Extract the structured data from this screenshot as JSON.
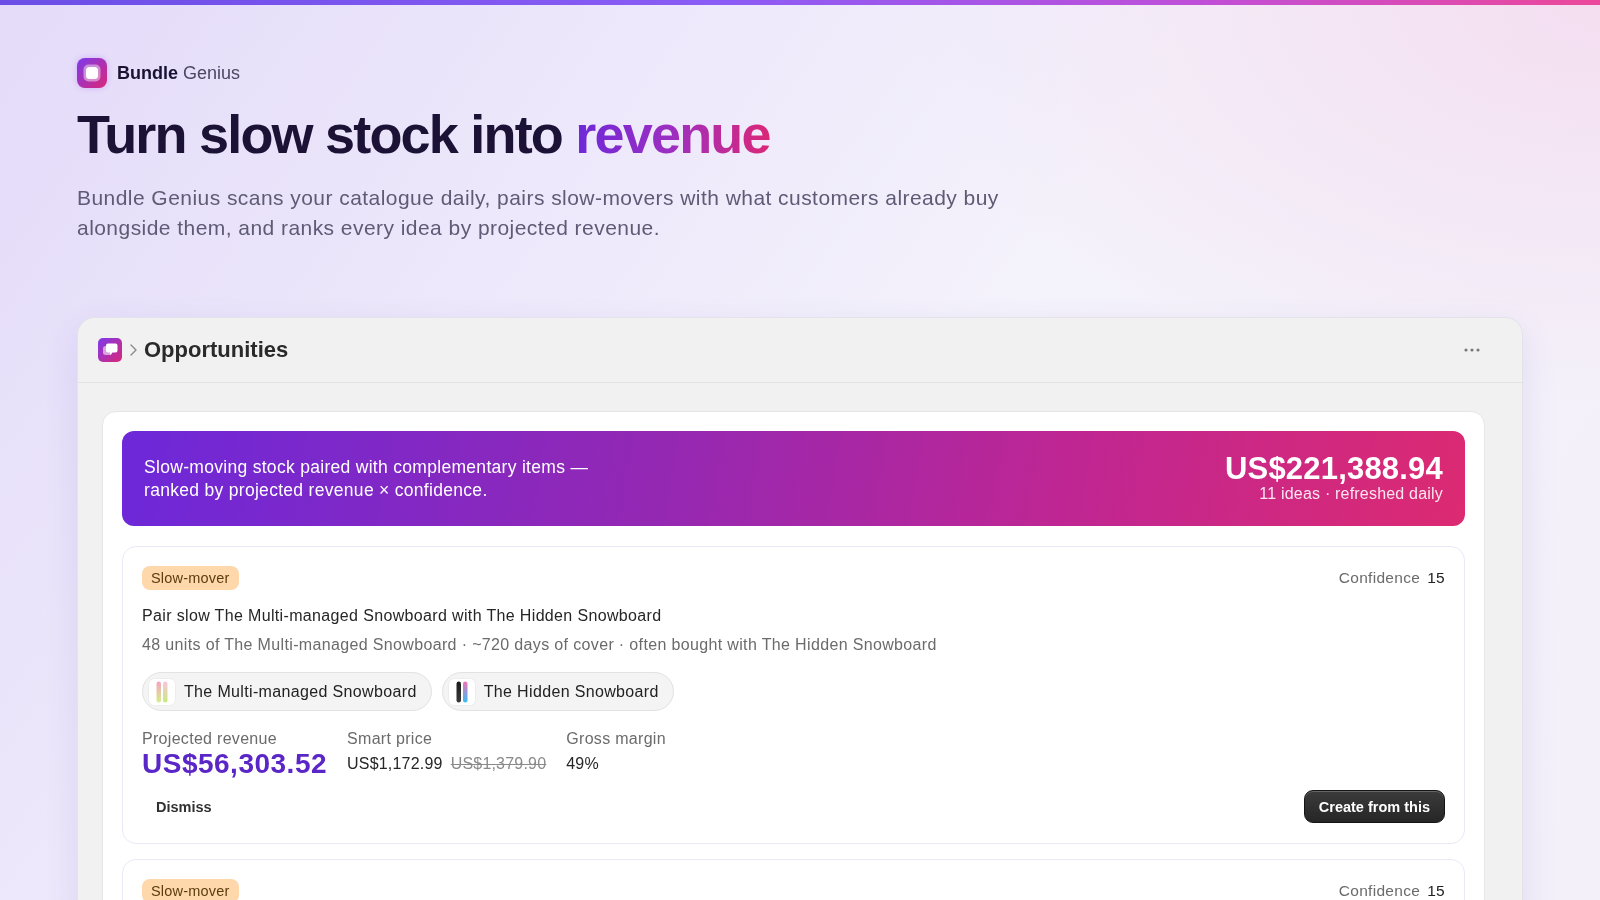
{
  "brand": {
    "name": "**Bundle** Genius"
  },
  "hero": {
    "title": "Turn slow stock into",
    "title_highlight": "revenue",
    "subtitle_lines": [
      "Bundle Genius scans your catalogue daily, pairs slow-movers with what customers already buy",
      "alongside them, and ranks every idea by projected revenue."
    ]
  },
  "panel": {
    "title": "Opportunities"
  },
  "summary": {
    "text_lines": [
      "Slow-moving stock paired with complementary items —",
      "ranked by projected revenue × confidence."
    ],
    "total": "US$221,388.94",
    "caption": "11 ideas · refreshed daily"
  },
  "opportunities": [
    {
      "badge": "Slow-mover",
      "confidence_label": "Confidence",
      "confidence": "15",
      "title": "Pair slow The Multi-managed Snowboard with The Hidden Snowboard",
      "detail": "48 units of The Multi-managed Snowboard · ~720 days of cover · often bought with The Hidden Snowboard",
      "products": [
        {
          "name": "The Multi-managed Snowboard"
        },
        {
          "name": "The Hidden Snowboard"
        }
      ],
      "metrics": [
        {
          "kind": "revenue",
          "label": "Projected revenue",
          "value": "US$56,303.52"
        },
        {
          "kind": "price",
          "label": "Smart price",
          "value": "US$1,172.99",
          "was": "US$1,379.90"
        },
        {
          "kind": "plain",
          "label": "Gross margin",
          "value": "49%"
        }
      ],
      "actions": [
        {
          "kind": "plain",
          "label": "Dismiss"
        },
        {
          "kind": "primary",
          "label": "Create from this"
        }
      ]
    },
    {
      "badge": "Slow-mover",
      "confidence_label": "Confidence",
      "confidence": "15"
    }
  ]
}
